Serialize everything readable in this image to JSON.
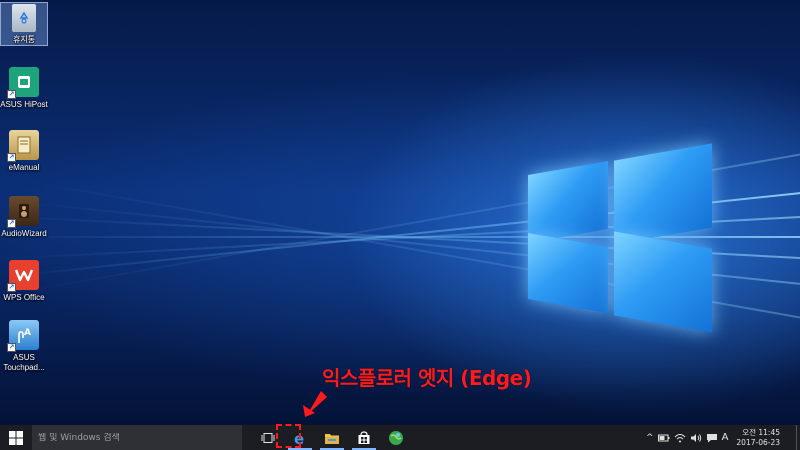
{
  "desktop": {
    "icons": [
      {
        "label": "휴지통",
        "icon": "recycle-bin-icon"
      },
      {
        "label": "ASUS HiPost",
        "icon": "hipost-icon"
      },
      {
        "label": "eManual",
        "icon": "emanual-icon"
      },
      {
        "label": "AudioWizard",
        "icon": "audiowizard-icon"
      },
      {
        "label": "WPS Office",
        "icon": "wps-office-icon"
      },
      {
        "label": "ASUS Touchpad...",
        "icon": "touchpad-icon"
      }
    ]
  },
  "annotation": {
    "text": "익스플로러 엣지 (Edge)",
    "color": "#ff1b1b"
  },
  "taskbar": {
    "search_placeholder": "웹 및 Windows 검색",
    "pinned": [
      {
        "name": "task-view",
        "icon": "task-view-icon"
      },
      {
        "name": "edge",
        "icon": "edge-icon"
      },
      {
        "name": "file-explorer",
        "icon": "folder-icon"
      },
      {
        "name": "store",
        "icon": "store-icon"
      },
      {
        "name": "browser",
        "icon": "globe-icon"
      }
    ],
    "tray": {
      "ime": "A",
      "time": "오전 11:45",
      "date": "2017-06-23"
    }
  },
  "colors": {
    "taskbar_bg": "#1b1d22",
    "accent": "#2e9cf5"
  }
}
